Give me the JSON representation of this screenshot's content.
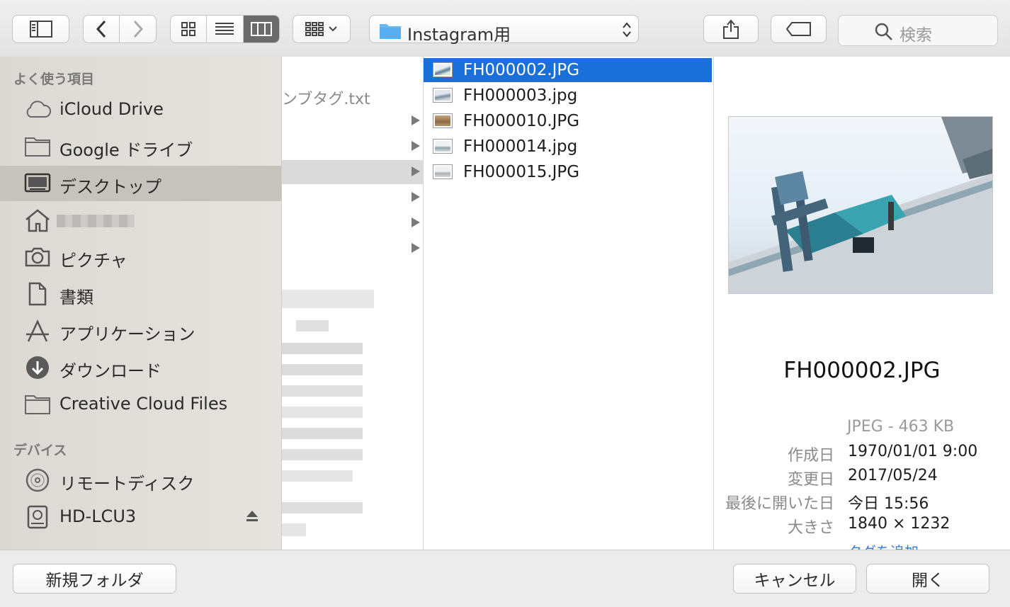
{
  "toolbar": {
    "path_label": "Instagram用",
    "search_placeholder": "検索"
  },
  "sidebar": {
    "favorites_header": "よく使う項目",
    "devices_header": "デバイス",
    "items": [
      {
        "label": "iCloud Drive",
        "icon": "cloud-icon"
      },
      {
        "label": "Google ドライブ",
        "icon": "folder-icon"
      },
      {
        "label": "デスクトップ",
        "icon": "desktop-icon",
        "selected": true
      },
      {
        "label": "",
        "icon": "home-icon"
      },
      {
        "label": "ピクチャ",
        "icon": "camera-icon"
      },
      {
        "label": "書類",
        "icon": "document-icon"
      },
      {
        "label": "アプリケーション",
        "icon": "applications-icon"
      },
      {
        "label": "ダウンロード",
        "icon": "download-icon"
      },
      {
        "label": "Creative Cloud Files",
        "icon": "folder-icon"
      }
    ],
    "devices": [
      {
        "label": "リモートディスク",
        "icon": "disc-icon"
      },
      {
        "label": "HD-LCU3",
        "icon": "external-drive-icon"
      }
    ]
  },
  "column1": {
    "partial_item": "ンブタグ.txt"
  },
  "files": [
    {
      "name": "FH000002.JPG",
      "selected": true
    },
    {
      "name": "FH000003.jpg"
    },
    {
      "name": "FH000010.JPG"
    },
    {
      "name": "FH000014.jpg"
    },
    {
      "name": "FH000015.JPG"
    }
  ],
  "preview": {
    "filename": "FH000002.JPG",
    "kind": "JPEG - 463 KB",
    "created_label": "作成日",
    "created_value": "1970/01/01 9:00",
    "modified_label": "変更日",
    "modified_value": "2017/05/24",
    "last_opened_label": "最後に開いた日",
    "last_opened_value": "今日 15:56",
    "size_label": "大きさ",
    "size_value": "1840 × 1232",
    "add_tags": "タグを追加..."
  },
  "footer": {
    "new_folder": "新規フォルダ",
    "cancel": "キャンセル",
    "open": "開く"
  },
  "colors": {
    "selection": "#1a6fd8",
    "sidebar_selected": "#c6c3bc"
  }
}
